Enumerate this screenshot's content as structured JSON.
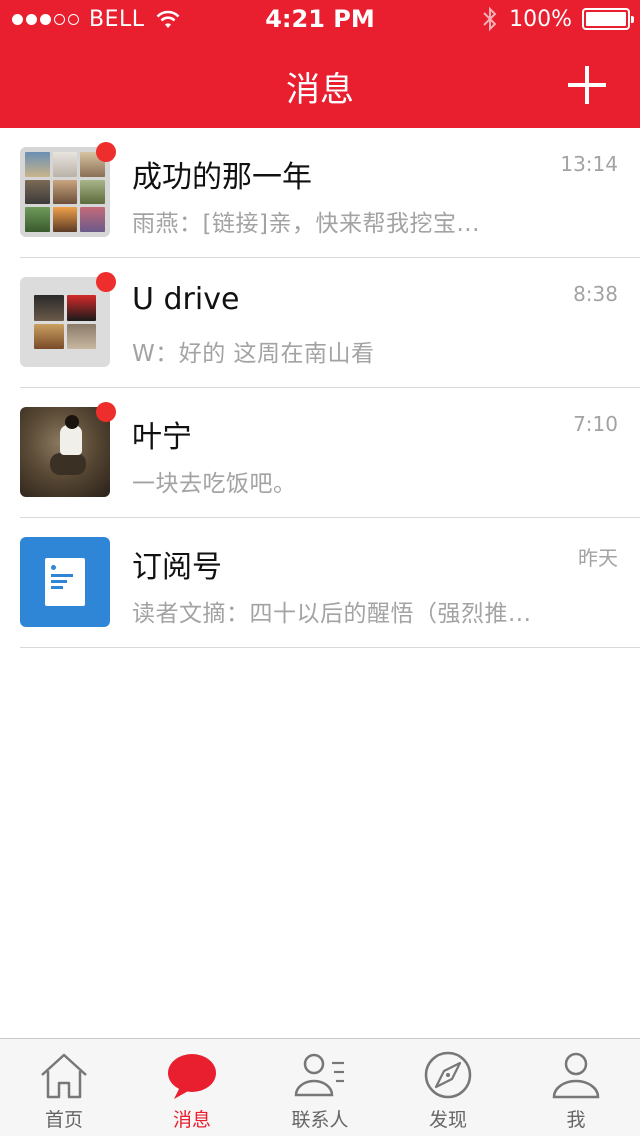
{
  "status_bar": {
    "carrier": "BELL",
    "time": "4:21 PM",
    "battery": "100%",
    "battery_level": 1.0,
    "signal_bars_filled": 3,
    "signal_bars_total": 5
  },
  "nav": {
    "title": "消息",
    "add_icon": "plus-icon"
  },
  "conversations": [
    {
      "name": "成功的那一年",
      "preview": "雨燕：[链接]亲，快来帮我挖宝...",
      "time": "13:14",
      "unread": true,
      "avatar": "group-photo-grid"
    },
    {
      "name": "U drive",
      "preview": "W：好的  这周在南山看",
      "time": "8:38",
      "unread": true,
      "avatar": "group-photo-grid-small"
    },
    {
      "name": "叶宁",
      "preview": "一块去吃饭吧。",
      "time": "7:10",
      "unread": true,
      "avatar": "person-photo"
    },
    {
      "name": "订阅号",
      "preview": "读者文摘：四十以后的醒悟（强烈推...",
      "time": "昨天",
      "unread": false,
      "avatar": "subscription-doc-icon"
    }
  ],
  "tabs": [
    {
      "label": "首页",
      "icon": "home-icon",
      "active": false
    },
    {
      "label": "消息",
      "icon": "chat-bubble-icon",
      "active": true
    },
    {
      "label": "联系人",
      "icon": "contacts-icon",
      "active": false
    },
    {
      "label": "发现",
      "icon": "compass-icon",
      "active": false
    },
    {
      "label": "我",
      "icon": "person-icon",
      "active": false
    }
  ],
  "colors": {
    "accent": "#e91e2f",
    "unread_dot": "#ee2d2d",
    "subscription_blue": "#2f86d6",
    "secondary_text": "#a3a3a3"
  }
}
